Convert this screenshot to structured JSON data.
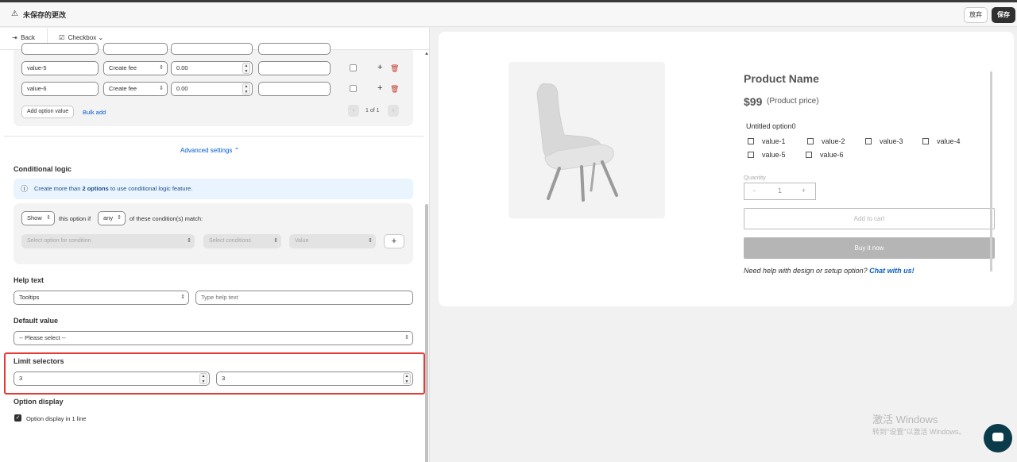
{
  "topbar": {
    "title": "未保存的更改",
    "discard": "放弃",
    "save": "保存"
  },
  "nav": {
    "back": "Back",
    "type": "Checkbox"
  },
  "options": {
    "rows": [
      {
        "value": "value-5",
        "fee_type": "Create fee",
        "amount": "0.00"
      },
      {
        "value": "value-6",
        "fee_type": "Create fee",
        "amount": "0.00"
      }
    ],
    "add_option": "Add option value",
    "bulk_add": "Bulk add",
    "pager": "1 of 1"
  },
  "advanced": {
    "label": "Advanced settings"
  },
  "conditional": {
    "title": "Conditional logic",
    "info_prefix": "Create more than ",
    "info_bold": "2 options",
    "info_suffix": " to use conditional logic feature.",
    "show": "Show",
    "this_option_if": "this option if",
    "any": "any",
    "of_conditions": "of these condition(s) match:",
    "select_option_placeholder": "Select option for condition",
    "select_conditions": "Select conditions",
    "value": "Value"
  },
  "help_text": {
    "title": "Help text",
    "type": "Tooltips",
    "placeholder": "Type help text"
  },
  "default_value": {
    "title": "Default value",
    "placeholder": "-- Please select --"
  },
  "limit": {
    "title": "Limit selectors",
    "min": "3",
    "max": "3"
  },
  "option_display": {
    "title": "Option display",
    "checkbox_label": "Option display in 1 line",
    "checked": true
  },
  "preview": {
    "product_name": "Product Name",
    "price": "$99",
    "price_note": "(Product price)",
    "option_label": "Untitled option0",
    "values": [
      "value-1",
      "value-2",
      "value-3",
      "value-4",
      "value-5",
      "value-6"
    ],
    "quantity_label": "Quantity",
    "quantity_minus": "-",
    "quantity": "1",
    "quantity_plus": "+",
    "add_to_cart": "Add to cart",
    "buy_now": "Buy it now",
    "help_prefix": "Need help with design or setup option? ",
    "help_link": "Chat with us!"
  },
  "watermark": {
    "line1": "激活 Windows",
    "line2": "转到\"设置\"以激活 Windows。"
  },
  "icons": {
    "warning": "warning-icon",
    "back": "back-arrow-icon",
    "checkbox": "checkbox-icon",
    "info": "info-icon",
    "chat": "chat-icon"
  }
}
